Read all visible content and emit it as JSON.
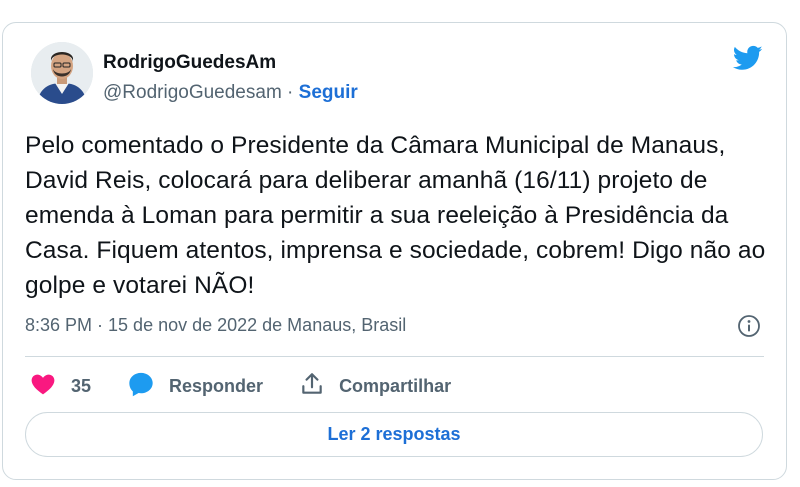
{
  "tweet": {
    "author_name": "RodrigoGuedesAm",
    "author_handle": "@RodrigoGuedesam",
    "separator": "·",
    "follow_label": "Seguir",
    "text": "Pelo comentado o Presidente da Câmara Municipal de Manaus, David Reis, colocará para deliberar amanhã (16/11) projeto de emenda à Loman para permitir a sua reeleição à Presidência da Casa. Fiquem atentos, imprensa e sociedade, cobrem! Digo não ao golpe e votarei NÃO!",
    "meta": "8:36 PM · 15 de nov de 2022 de Manaus, Brasil"
  },
  "actions": {
    "like_count": "35",
    "reply_label": "Responder",
    "share_label": "Compartilhar"
  },
  "read_replies_label": "Ler 2 respostas",
  "icons": {
    "brand": "twitter-bird-icon",
    "info": "info-icon",
    "like": "heart-icon",
    "reply": "comment-bubble-icon",
    "share": "share-icon"
  },
  "colors": {
    "twitter_blue": "#1d9bf0",
    "link_blue": "#1d6fd6",
    "like_pink": "#f91880",
    "text": "#0f1419",
    "muted": "#536471",
    "border": "#cfd9de"
  }
}
